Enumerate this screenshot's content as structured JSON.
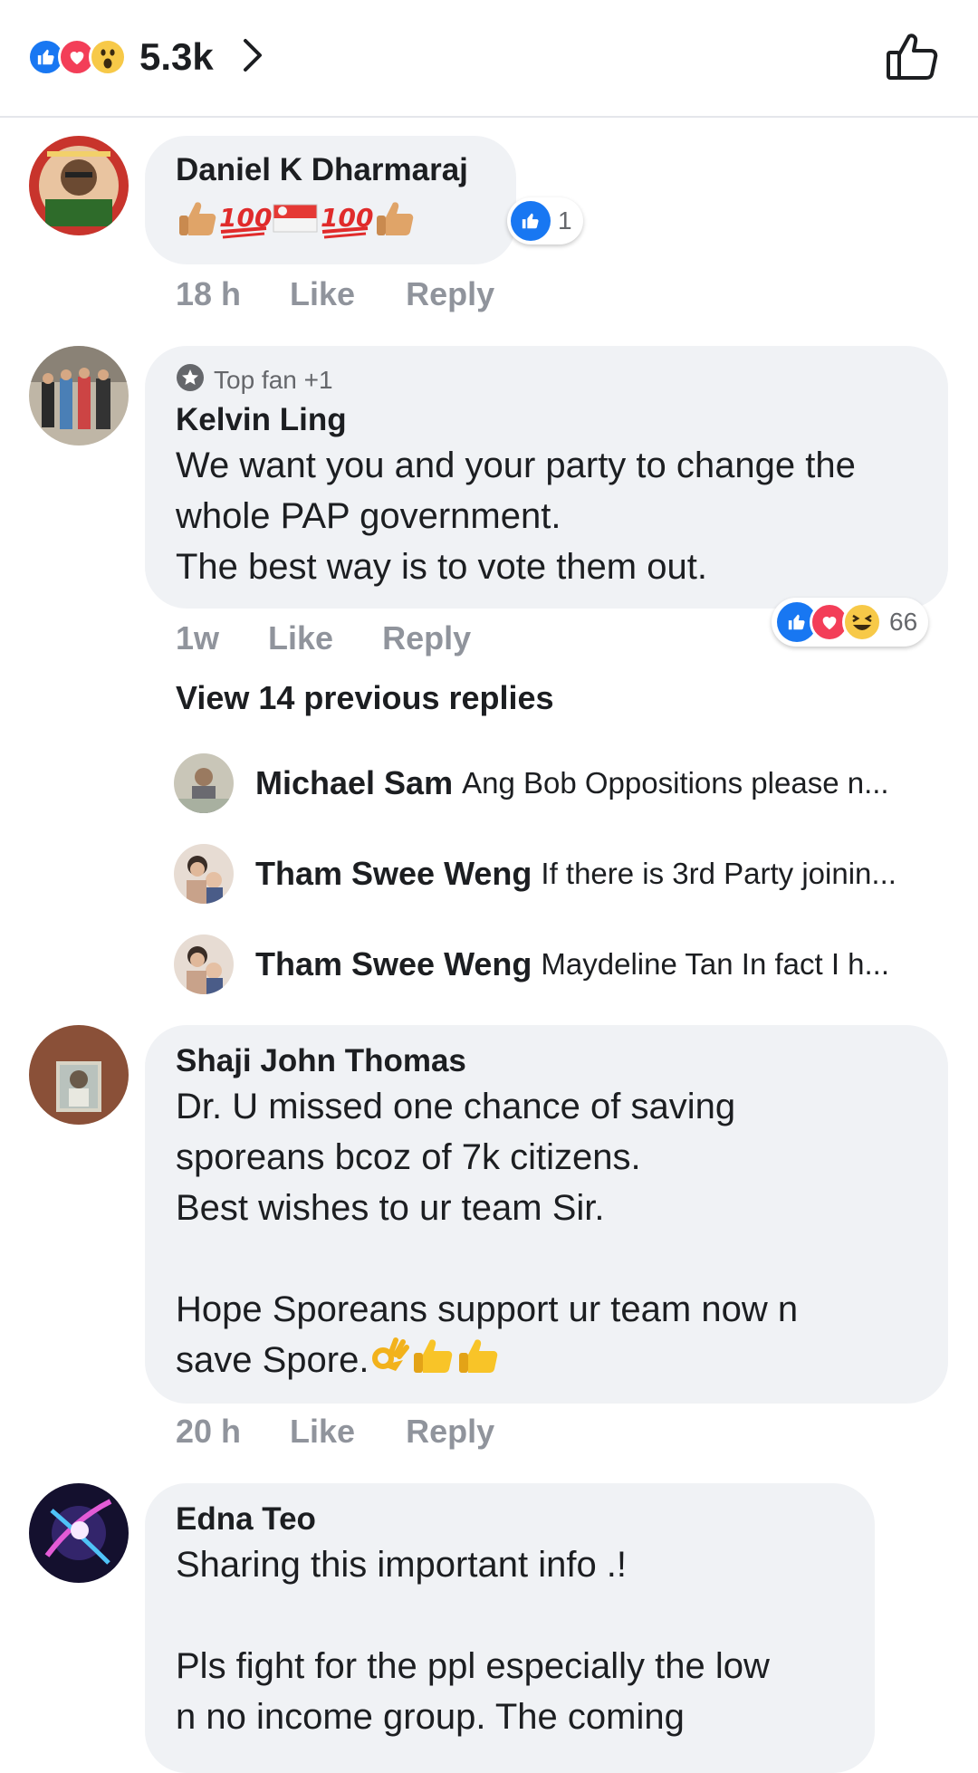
{
  "header": {
    "reaction_count": "5.3k",
    "reaction_icons": [
      "like-icon",
      "love-icon",
      "wow-icon"
    ],
    "like_icon": "thumbs-up-outline-icon"
  },
  "colors": {
    "like_blue": "#1877f2",
    "love_red": "#f33e58",
    "bubble_bg": "#f0f2f5",
    "meta_gray": "#90949c"
  },
  "comments": [
    {
      "author": "Daniel K Dharmaraj",
      "text_emojis": [
        "thumbs-up-emoji",
        "hundred-points-emoji",
        "singapore-flag-emoji",
        "hundred-points-emoji",
        "thumbs-up-emoji"
      ],
      "reaction_count": "1",
      "time": "18 h",
      "like": "Like",
      "reply": "Reply"
    },
    {
      "badge": "Top fan +1",
      "author": "Kelvin Ling",
      "text": "We want you and your party to change the\nwhole PAP government.\nThe best way is to vote them out.",
      "reaction_count": "66",
      "time": "1w",
      "like": "Like",
      "reply": "Reply",
      "view_previous": "View 14 previous replies",
      "replies": [
        {
          "author": "Michael Sam",
          "snippet": "Ang Bob Oppositions please n..."
        },
        {
          "author": "Tham Swee Weng",
          "snippet": "If there is 3rd Party joinin..."
        },
        {
          "author": "Tham Swee Weng",
          "snippet": "Maydeline Tan In fact I h..."
        }
      ]
    },
    {
      "author": "Shaji John Thomas",
      "text": "Dr. U missed one chance of saving\nsporeans bcoz of 7k citizens.\nBest wishes to ur team Sir.\n\nHope Sporeans support ur team now n\nsave Spore.",
      "trailing_emojis": [
        "ok-hand-emoji",
        "thumbs-up-emoji",
        "thumbs-up-emoji"
      ],
      "time": "20 h",
      "like": "Like",
      "reply": "Reply"
    },
    {
      "author": "Edna Teo",
      "text": "Sharing this important info .!\n\nPls fight for the ppl especially the low\nn no income group. The coming"
    }
  ]
}
